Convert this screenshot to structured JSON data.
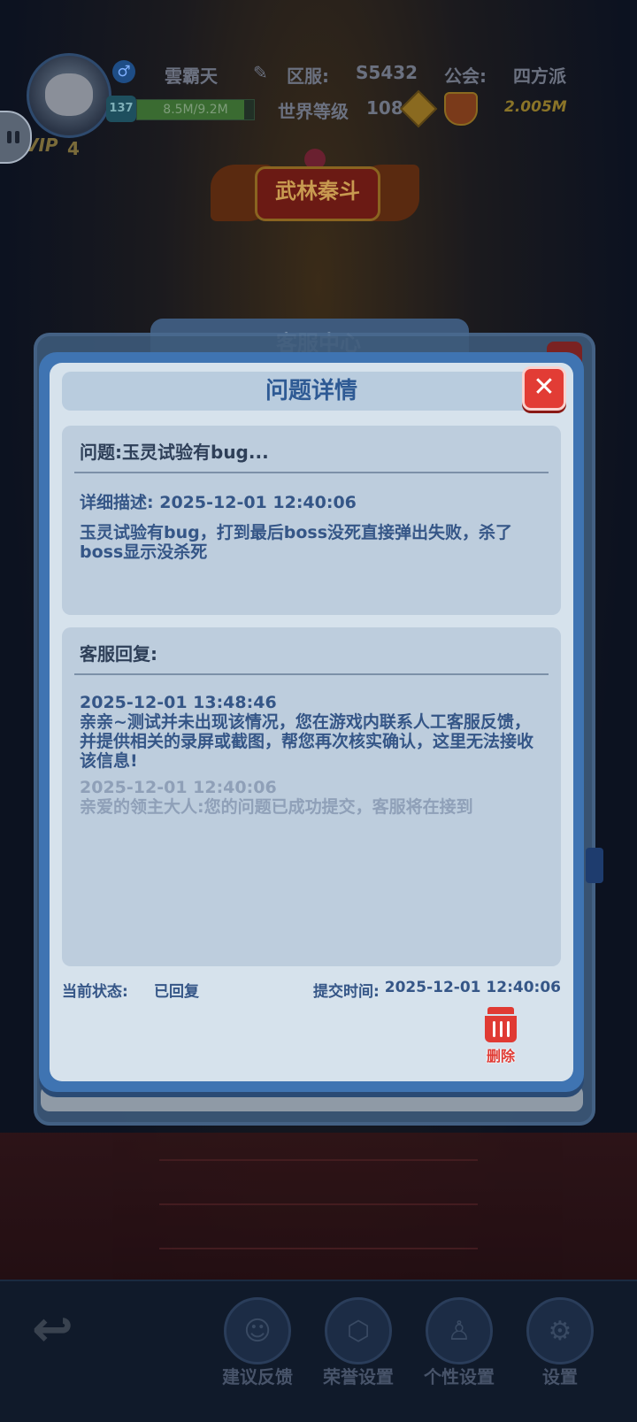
{
  "player": {
    "name": "雲霸天",
    "vip_label": "VIP",
    "vip_level": "4",
    "level": "137",
    "exp_text": "8.5M/9.2M",
    "exp_fraction": 0.92,
    "server_label": "区服:",
    "server_value": "S5432",
    "guild_label": "公会:",
    "guild_value": "四方派",
    "world_level_label": "世界等级",
    "world_level_value": "108",
    "power": "2.005M"
  },
  "banner": {
    "title": "武林秦斗"
  },
  "back_dialog": {
    "title": "客服中心"
  },
  "dialog": {
    "title": "问题详情",
    "close_glyph": "✕",
    "question": {
      "heading": "问题:玉灵试验有bug...",
      "detail_label": "详细描述:",
      "detail_time": "2025-12-01 12:40:06",
      "body": "玉灵试验有bug，打到最后boss没死直接弹出失败，杀了boss显示没杀死"
    },
    "reply": {
      "heading": "客服回复:",
      "messages": [
        {
          "time": "2025-12-01 13:48:46",
          "text": "亲亲~测试并未出现该情况，您在游戏内联系人工客服反馈，并提供相关的录屏或截图，帮您再次核实确认，这里无法接收该信息!"
        },
        {
          "time": "2025-12-01 12:40:06",
          "text": "亲爱的领主大人:您的问题已成功提交，客服将在接到"
        }
      ]
    },
    "status_label": "当前状态:",
    "status_value": "已回复",
    "submit_label": "提交时间:",
    "submit_value": "2025-12-01 12:40:06",
    "delete_label": "删除"
  },
  "bottom_nav": [
    {
      "label": "建议反馈",
      "icon": "feedback-headset-icon"
    },
    {
      "label": "荣誉设置",
      "icon": "honor-hexagon-icon"
    },
    {
      "label": "个性设置",
      "icon": "person-icon"
    },
    {
      "label": "设置",
      "icon": "gear-icon"
    }
  ]
}
